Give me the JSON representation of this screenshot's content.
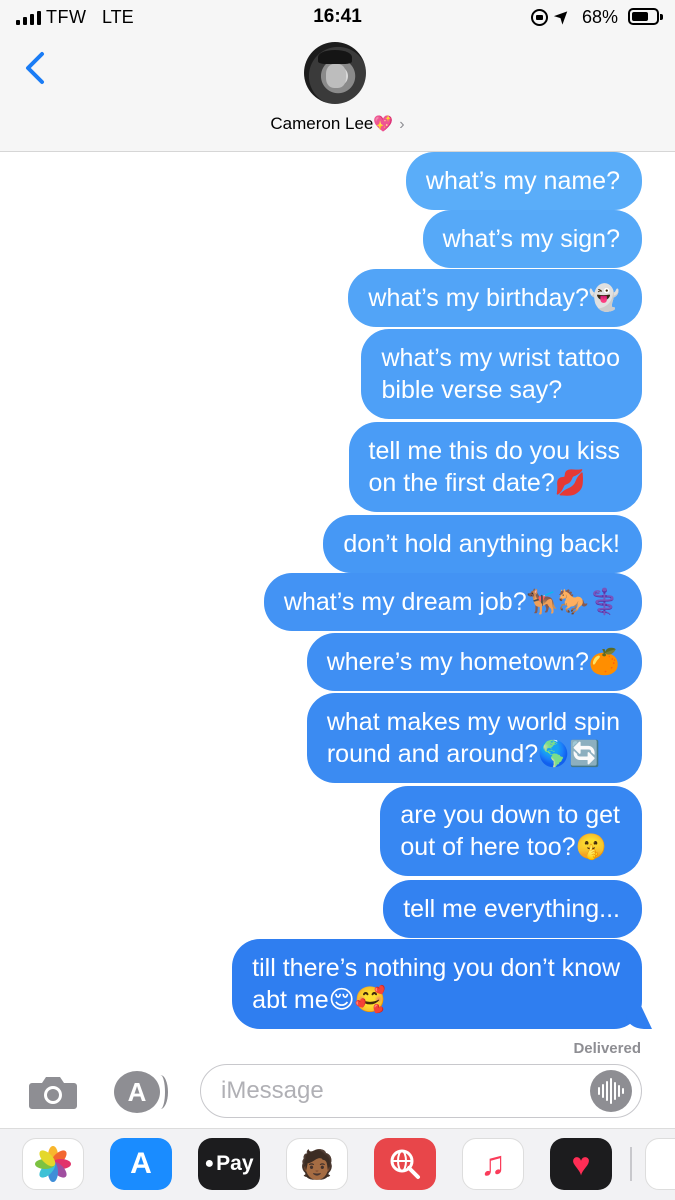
{
  "status_bar": {
    "carrier": "TFW",
    "network": "LTE",
    "time": "16:41",
    "battery_percent": "68%",
    "battery_level": 0.68
  },
  "header": {
    "contact_name": "Cameron Lee",
    "contact_emoji": "💖",
    "chevron": "›"
  },
  "messages": [
    {
      "text": "what’s my name?"
    },
    {
      "text": "what’s my sign?"
    },
    {
      "text": "what’s my birthday?👻"
    },
    {
      "text": "what’s my wrist tattoo\nbible verse say?"
    },
    {
      "text": "tell me this do you kiss\non the first date?💋"
    },
    {
      "text": "don’t hold anything back!"
    },
    {
      "text": "what’s my dream job?🐕‍🦺🐎⚕️"
    },
    {
      "text": "where’s my hometown?🍊"
    },
    {
      "text": "what makes my world spin\nround and around?🌎🔄"
    },
    {
      "text": "are you down to get\nout of here too?🤫"
    },
    {
      "text": "tell me everything..."
    },
    {
      "text": "till there’s nothing you don’t know\nabt me😌🥰"
    }
  ],
  "delivered_label": "Delivered",
  "composer": {
    "placeholder": "iMessage",
    "value": ""
  },
  "app_drawer": {
    "apps": [
      {
        "name": "photos-app",
        "label": "",
        "color": "#ffffff"
      },
      {
        "name": "app-store-app",
        "label": "A",
        "color": "#1a8cff"
      },
      {
        "name": "apple-pay-app",
        "label": "Pay",
        "color": "#1c1c1e"
      },
      {
        "name": "memoji-app",
        "label": "",
        "color": "#ffffff"
      },
      {
        "name": "search-images-app",
        "label": "",
        "color": "#e8464a"
      },
      {
        "name": "music-app",
        "label": "♫",
        "color": "#ffffff"
      },
      {
        "name": "digital-touch-app",
        "label": "♥",
        "color": "#1c1c1e"
      }
    ]
  },
  "colors": {
    "bubble_top": "#5aadf9",
    "bubble_bottom": "#2f7ef0",
    "ios_blue": "#1a7cf5",
    "gray": "#8e8e93"
  }
}
